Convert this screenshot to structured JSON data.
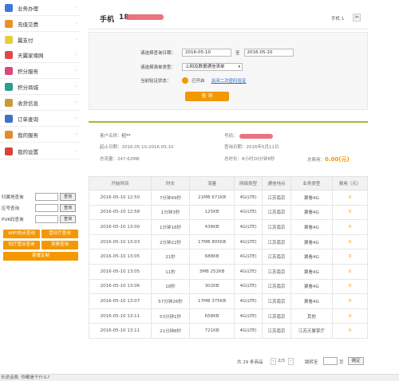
{
  "sidebar": {
    "items": [
      {
        "label": "业务办理",
        "color": "#3b7bd8"
      },
      {
        "label": "充值交费",
        "color": "#e8912a"
      },
      {
        "label": "翼支付",
        "color": "#e5cf3d"
      },
      {
        "label": "天翼家缘网",
        "color": "#e04848"
      },
      {
        "label": "积分服务",
        "color": "#d94b76"
      },
      {
        "label": "积分商城",
        "color": "#2c9c8e"
      },
      {
        "label": "收货信息",
        "color": "#c99a3c"
      },
      {
        "label": "订单查询",
        "color": "#3d72c7"
      },
      {
        "label": "我的服务",
        "color": "#e08c2f"
      },
      {
        "label": "我的设置",
        "color": "#d9443a"
      }
    ],
    "quick": [
      {
        "label": "归属地查询",
        "button": "查询"
      },
      {
        "label": "区号查询",
        "button": "查询"
      },
      {
        "label": "PUK码查询",
        "button": "查询"
      }
    ],
    "orange_buttons": [
      "WIFI热点查询",
      "营业厅查询",
      "知厅营业查询",
      "资费查询",
      "套餐定制"
    ]
  },
  "phone_bar": {
    "title": "手机",
    "number_visible": "18",
    "right_label": "手机 1"
  },
  "filter": {
    "date_label": "请选择查询日期：",
    "date_from": "2016-05-10",
    "to": "至",
    "date_to": "2016-05-10",
    "type_label": "请选择清单类型：",
    "type_value": "上网及数据通信清单",
    "verify_label": "当前验证状态：",
    "verify_status": "已开启",
    "verify_link": "关闭二次密码验证",
    "query_button": "查 询"
  },
  "customer": {
    "name_label": "客户名称：",
    "name_value": "杞**",
    "number_label": "号码：",
    "period_label": "起止日期：",
    "period_value": "2016.05.10-2016.05.10",
    "query_time_label": "查询日期：",
    "query_time_value": "2016年5月11日",
    "traffic_label": "总流量：",
    "traffic_value": "247.62MB",
    "duration_label": "总时长：",
    "duration_value": "8小时20分钟8秒",
    "fee_label": "总费用：",
    "fee_value": "0.00(元)"
  },
  "table": {
    "headers": [
      "开始时间",
      "时长",
      "流量",
      "网络类型",
      "通信地点",
      "业务类型",
      "费用（元）"
    ],
    "rows": [
      [
        "2016-05-10 12:50",
        "7分钟49秒",
        "21MB 671KB",
        "4G(LTE)",
        "江苏南京",
        "翼看4G",
        "0"
      ],
      [
        "2016-05-10 12:58",
        "1分钟3秒",
        "125KB",
        "4G(LTE)",
        "江苏南京",
        "翼看4G",
        "0"
      ],
      [
        "2016-05-10 13:00",
        "1分钟16秒",
        "438KB",
        "4G(LTE)",
        "江苏南京",
        "翼看4G",
        "0"
      ],
      [
        "2016-05-10 13:03",
        "2分钟22秒",
        "17MB 805KB",
        "4G(LTE)",
        "江苏南京",
        "翼看4G",
        "0"
      ],
      [
        "2016-05-10 13:05",
        "21秒",
        "688KB",
        "4G(LTE)",
        "江苏南京",
        "翼看4G",
        "0"
      ],
      [
        "2016-05-10 13:05",
        "11秒",
        "3MB 252KB",
        "4G(LTE)",
        "江苏南京",
        "翼看4G",
        "0"
      ],
      [
        "2016-05-10 13:06",
        "18秒",
        "302KB",
        "4G(LTE)",
        "江苏南京",
        "翼看4G",
        "0"
      ],
      [
        "2016-05-10 13:07",
        "57分钟26秒",
        "17MB 375KB",
        "4G(LTE)",
        "江苏南京",
        "翼看4G",
        "0"
      ],
      [
        "2016-05-10 13:11",
        "53分钟1秒",
        "658KB",
        "4G(LTE)",
        "江苏南京",
        "其他",
        "0"
      ],
      [
        "2016-05-10 13:11",
        "21分钟8秒",
        "721KB",
        "4G(LTE)",
        "江苏南京",
        "江苏天翼掌厅",
        "0"
      ]
    ]
  },
  "pager": {
    "summary": "共 29 条商品",
    "page": "2/3",
    "goto_label": "跳转至",
    "unit": "页",
    "confirm": "确定"
  },
  "status_bar": {
    "text": "长途话费, 你都是干什么?"
  }
}
